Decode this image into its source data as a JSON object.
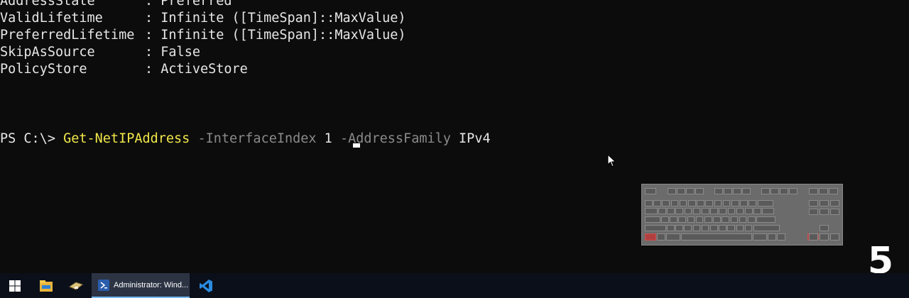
{
  "terminal": {
    "output_lines": [
      {
        "key": "AddressState",
        "value": "Preferred"
      },
      {
        "key": "ValidLifetime",
        "value": "Infinite ([TimeSpan]::MaxValue)"
      },
      {
        "key": "PreferredLifetime",
        "value": "Infinite ([TimeSpan]::MaxValue)"
      },
      {
        "key": "SkipAsSource",
        "value": "False"
      },
      {
        "key": "PolicyStore",
        "value": "ActiveStore"
      }
    ],
    "prompt": "PS C:\\> ",
    "cmdlet": "Get-NetIPAddress",
    "param1": " -InterfaceIndex",
    "arg1": " 1 ",
    "param2": "-AddressFamily",
    "arg2": " IPv4"
  },
  "keyboard_overlay": {
    "pressed_keys": [
      "ctrl-left",
      "ctrl-right"
    ]
  },
  "step_counter": "5",
  "taskbar": {
    "active_app_label": "Administrator: Wind...",
    "icons": [
      "windows-start-icon",
      "file-explorer-icon",
      "usb-drive-icon",
      "powershell-icon",
      "vscode-icon"
    ]
  },
  "colors": {
    "background": "#0c0c0c",
    "cmdlet": "#f0e64a",
    "parameter": "#8a8a8a",
    "text": "#e6e6e6"
  }
}
